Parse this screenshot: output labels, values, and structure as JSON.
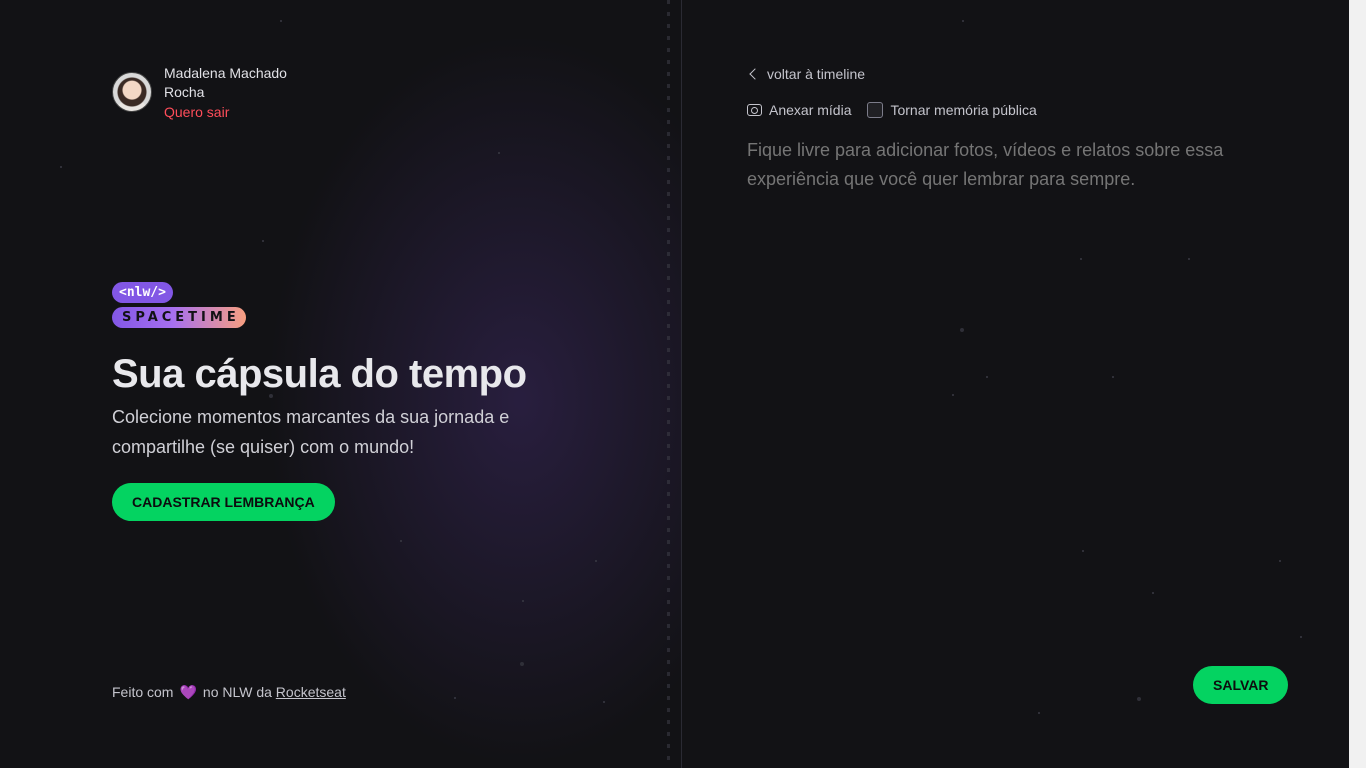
{
  "user": {
    "name": "Madalena Machado Rocha",
    "logout_label": "Quero sair"
  },
  "logo": {
    "tag": "<nlw/>",
    "word": "SPACETIME"
  },
  "hero": {
    "title": "Sua cápsula do tempo",
    "subtitle": "Colecione momentos marcantes da sua jornada e compartilhe (se quiser) com o mundo!",
    "cta_label": "CADASTRAR LEMBRANÇA"
  },
  "footer": {
    "prefix": "Feito com",
    "heart": "💜",
    "middle": "no NLW da",
    "link": "Rocketseat"
  },
  "form": {
    "back_label": "voltar à timeline",
    "attach_label": "Anexar mídia",
    "public_label": "Tornar memória pública",
    "content_placeholder": "Fique livre para adicionar fotos, vídeos e relatos sobre essa experiência que você quer lembrar para sempre.",
    "save_label": "SALVAR"
  },
  "colors": {
    "background": "#121215",
    "accent_green": "#04d361",
    "accent_purple": "#8257e5",
    "logout_red": "#ff4d5a"
  },
  "icons": [
    "avatar",
    "chevron-left-icon",
    "camera-icon",
    "checkbox",
    "heart-icon"
  ]
}
